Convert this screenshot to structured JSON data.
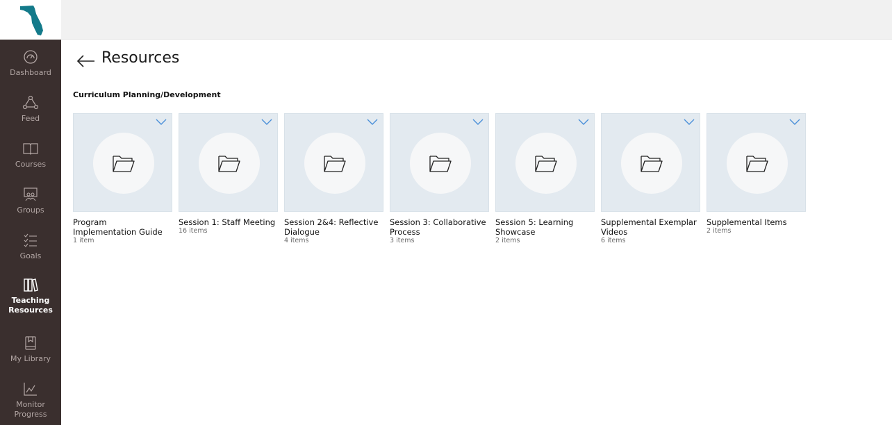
{
  "colors": {
    "sidebar_bg": "#3a2f2e",
    "thumb_bg": "#e3eaf0",
    "accent": "#4a90d9",
    "logo": "#137a8a"
  },
  "sidebar": {
    "items": [
      {
        "label": "Dashboard",
        "icon": "gauge-icon"
      },
      {
        "label": "Feed",
        "icon": "network-icon"
      },
      {
        "label": "Courses",
        "icon": "open-book-icon"
      },
      {
        "label": "Groups",
        "icon": "group-presentation-icon"
      },
      {
        "label": "Goals",
        "icon": "checklist-icon"
      },
      {
        "label": "Teaching Resources",
        "icon": "books-icon",
        "active": true
      },
      {
        "label": "My Library",
        "icon": "bookmark-book-icon"
      },
      {
        "label": "Monitor Progress",
        "icon": "line-chart-icon"
      }
    ]
  },
  "main": {
    "title": "Resources",
    "section_title": "Curriculum Planning/Development",
    "folders": [
      {
        "title": "Program Implementation Guide",
        "count": "1 item"
      },
      {
        "title": "Session 1: Staff Meeting",
        "count": "16 items"
      },
      {
        "title": "Session 2&4: Reflective Dialogue",
        "count": "4 items"
      },
      {
        "title": "Session 3: Collaborative Process",
        "count": "3 items"
      },
      {
        "title": "Session 5: Learning Showcase",
        "count": "2 items"
      },
      {
        "title": "Supplemental Exemplar Videos",
        "count": "6 items"
      },
      {
        "title": "Supplemental Items",
        "count": "2 items"
      }
    ]
  }
}
